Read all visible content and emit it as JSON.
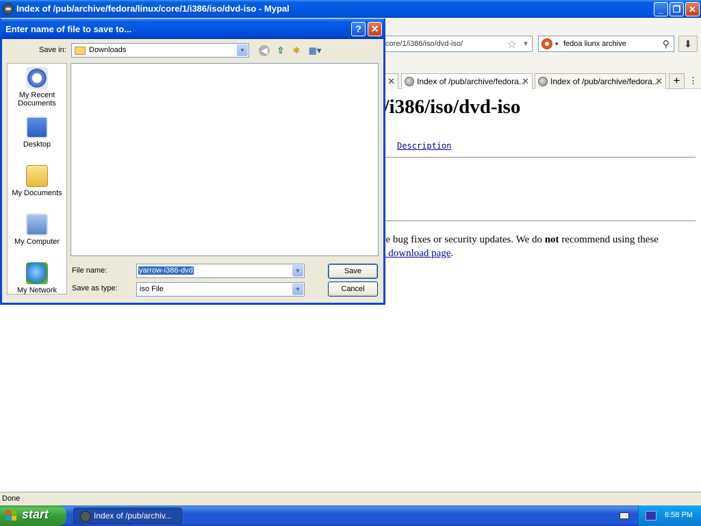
{
  "browser": {
    "title": "Index of /pub/archive/fedora/linux/core/1/i386/iso/dvd-iso - Mypal",
    "url_fragment": "core/1/i386/iso/dvd-iso/",
    "search_query": "fedoa liunx archive",
    "tabs": [
      {
        "label": "Index of /pub/archive/fedora..."
      },
      {
        "label": "Index of /pub/archive/fedora..."
      }
    ],
    "page": {
      "heading_fragment": "1/i386/iso/dvd-iso",
      "column_header": "Description",
      "para1_a": "ve bug fixes or security updates. We do ",
      "para1_bold": "not",
      "para1_b": " recommend using these",
      "para2_link": "n download page",
      "para2_end": "."
    },
    "status": "Done"
  },
  "dialog": {
    "title": "Enter name of file to save to...",
    "help_label": "?",
    "close_label": "✕",
    "save_in_label": "Save in:",
    "save_in_value": "Downloads",
    "places": [
      {
        "label_line1": "My Recent",
        "label_line2": "Documents"
      },
      {
        "label_line1": "Desktop",
        "label_line2": ""
      },
      {
        "label_line1": "My Documents",
        "label_line2": ""
      },
      {
        "label_line1": "My Computer",
        "label_line2": ""
      },
      {
        "label_line1": "My Network",
        "label_line2": ""
      }
    ],
    "file_name_label": "File name:",
    "file_name_value": "yarrow-i386-dvd",
    "save_as_type_label": "Save as type:",
    "save_as_type_value": "iso File",
    "save_button": "Save",
    "cancel_button": "Cancel"
  },
  "taskbar": {
    "start_label": "start",
    "task_label": "Index of /pub/archiv...",
    "clock": "6:58 PM"
  },
  "colors": {
    "xp_blue": "#0055e5",
    "start_green": "#389e38",
    "link": "#00009c"
  }
}
